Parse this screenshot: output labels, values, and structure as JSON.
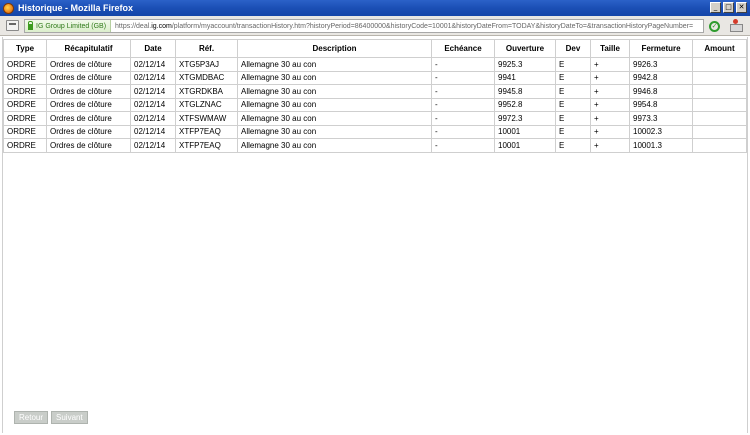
{
  "window": {
    "title": "Historique - Mozilla Firefox",
    "buttons": {
      "minimize": "_",
      "maximize": "□",
      "close": "✕"
    }
  },
  "addressbar": {
    "identity": "IG Group Limited (GB)",
    "url_prefix": "https://deal.",
    "url_domain": "ig.com",
    "url_rest": "/platform/myaccount/transactionHistory.htm?historyPeriod=86400000&historyCode=10001&historyDateFrom=TODAY&historyDateTo=&transactionHistoryPageNumber="
  },
  "table": {
    "columns": [
      "Type",
      "Récapitulatif",
      "Date",
      "Réf.",
      "Description",
      "Echéance",
      "Ouverture",
      "Dev",
      "Taille",
      "Fermeture",
      "Amount"
    ],
    "rows": [
      [
        "ORDRE",
        "Ordres de clôture",
        "02/12/14",
        "XTG5P3AJ",
        "Allemagne 30 au con",
        "-",
        "9925.3",
        "E",
        "+",
        "9926.3",
        ""
      ],
      [
        "ORDRE",
        "Ordres de clôture",
        "02/12/14",
        "XTGMDBAC",
        "Allemagne 30 au con",
        "-",
        "9941",
        "E",
        "+",
        "9942.8",
        ""
      ],
      [
        "ORDRE",
        "Ordres de clôture",
        "02/12/14",
        "XTGRDKBA",
        "Allemagne 30 au con",
        "-",
        "9945.8",
        "E",
        "+",
        "9946.8",
        ""
      ],
      [
        "ORDRE",
        "Ordres de clôture",
        "02/12/14",
        "XTGLZNAC",
        "Allemagne 30 au con",
        "-",
        "9952.8",
        "E",
        "+",
        "9954.8",
        ""
      ],
      [
        "ORDRE",
        "Ordres de clôture",
        "02/12/14",
        "XTFSWMAW",
        "Allemagne 30 au con",
        "-",
        "9972.3",
        "E",
        "+",
        "9973.3",
        ""
      ],
      [
        "ORDRE",
        "Ordres de clôture",
        "02/12/14",
        "XTFP7EAQ",
        "Allemagne 30 au con",
        "-",
        "10001",
        "E",
        "+",
        "10002.3",
        ""
      ],
      [
        "ORDRE",
        "Ordres de clôture",
        "02/12/14",
        "XTFP7EAQ",
        "Allemagne 30 au con",
        "-",
        "10001",
        "E",
        "+",
        "10001.3",
        ""
      ]
    ]
  },
  "pager": {
    "back_label": "Retour",
    "next_label": "Suivant"
  }
}
